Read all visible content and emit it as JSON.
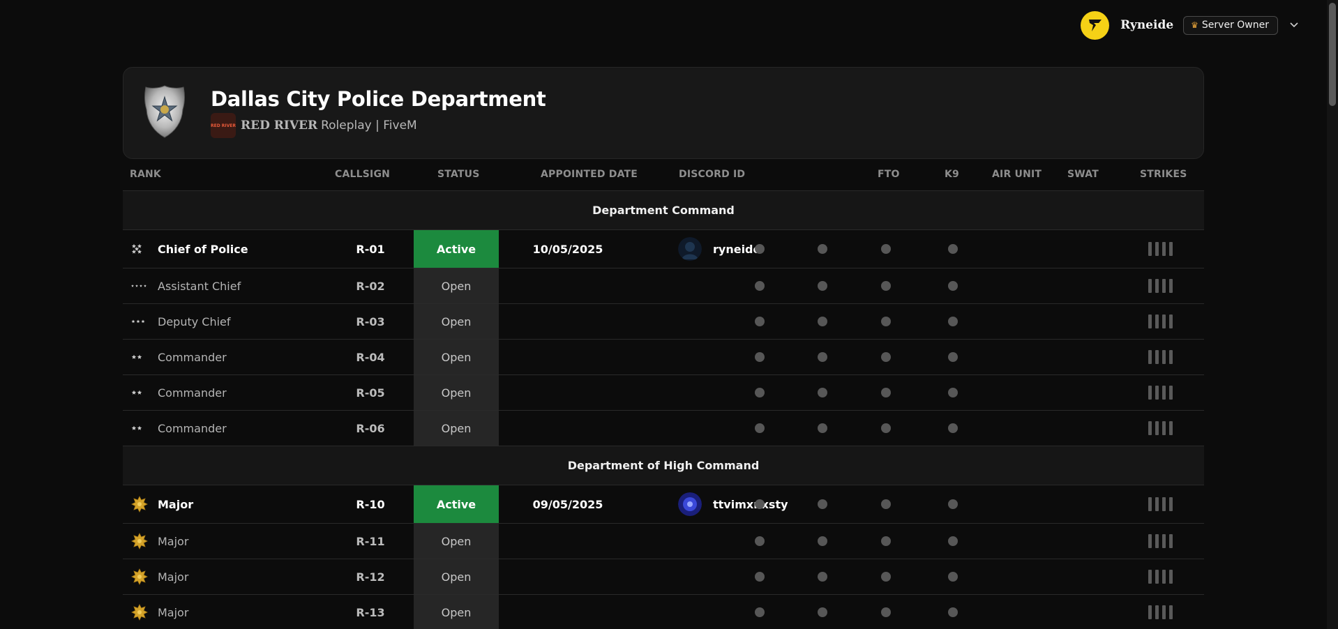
{
  "user": {
    "name": "Ryneide",
    "role": "Server Owner",
    "role_icon": "crown-icon",
    "brand_color": "#f5d116"
  },
  "department": {
    "title": "Dallas City Police Department",
    "server_logo_text": "RED RIVER",
    "server_name_a": "RED RIVER",
    "server_name_b": "Roleplay | FiveM"
  },
  "columns": {
    "rank": "RANK",
    "callsign": "CALLSIGN",
    "status": "STATUS",
    "appointed": "APPOINTED DATE",
    "discord": "DISCORD ID",
    "fto": "FTO",
    "k9": "K9",
    "air": "AIR UNIT",
    "swat": "SWAT",
    "strikes": "STRIKES"
  },
  "sections": [
    {
      "title": "Department Command",
      "rows": [
        {
          "rank": "Chief of Police",
          "insignia": "five-star",
          "callsign": "R-01",
          "status": "Active",
          "appointed": "10/05/2025",
          "discord": "ryneide",
          "strikes": 0
        },
        {
          "rank": "Assistant Chief",
          "insignia": "four-star",
          "callsign": "R-02",
          "status": "Open",
          "appointed": "",
          "discord": "",
          "strikes": 0
        },
        {
          "rank": "Deputy Chief",
          "insignia": "three-star",
          "callsign": "R-03",
          "status": "Open",
          "appointed": "",
          "discord": "",
          "strikes": 0
        },
        {
          "rank": "Commander",
          "insignia": "two-star",
          "callsign": "R-04",
          "status": "Open",
          "appointed": "",
          "discord": "",
          "strikes": 0
        },
        {
          "rank": "Commander",
          "insignia": "two-star",
          "callsign": "R-05",
          "status": "Open",
          "appointed": "",
          "discord": "",
          "strikes": 0
        },
        {
          "rank": "Commander",
          "insignia": "two-star",
          "callsign": "R-06",
          "status": "Open",
          "appointed": "",
          "discord": "",
          "strikes": 0
        }
      ]
    },
    {
      "title": "Department of High Command",
      "rows": [
        {
          "rank": "Major",
          "insignia": "oak-leaf",
          "callsign": "R-10",
          "status": "Active",
          "appointed": "09/05/2025",
          "discord": "ttvimxnxsty",
          "strikes": 0
        },
        {
          "rank": "Major",
          "insignia": "oak-leaf",
          "callsign": "R-11",
          "status": "Open",
          "appointed": "",
          "discord": "",
          "strikes": 0
        },
        {
          "rank": "Major",
          "insignia": "oak-leaf",
          "callsign": "R-12",
          "status": "Open",
          "appointed": "",
          "discord": "",
          "strikes": 0
        },
        {
          "rank": "Major",
          "insignia": "oak-leaf",
          "callsign": "R-13",
          "status": "Open",
          "appointed": "",
          "discord": "",
          "strikes": 0
        }
      ]
    }
  ],
  "colors": {
    "active": "#1c8a3e",
    "open": "#262626",
    "oak_leaf": "#d4a32a"
  }
}
